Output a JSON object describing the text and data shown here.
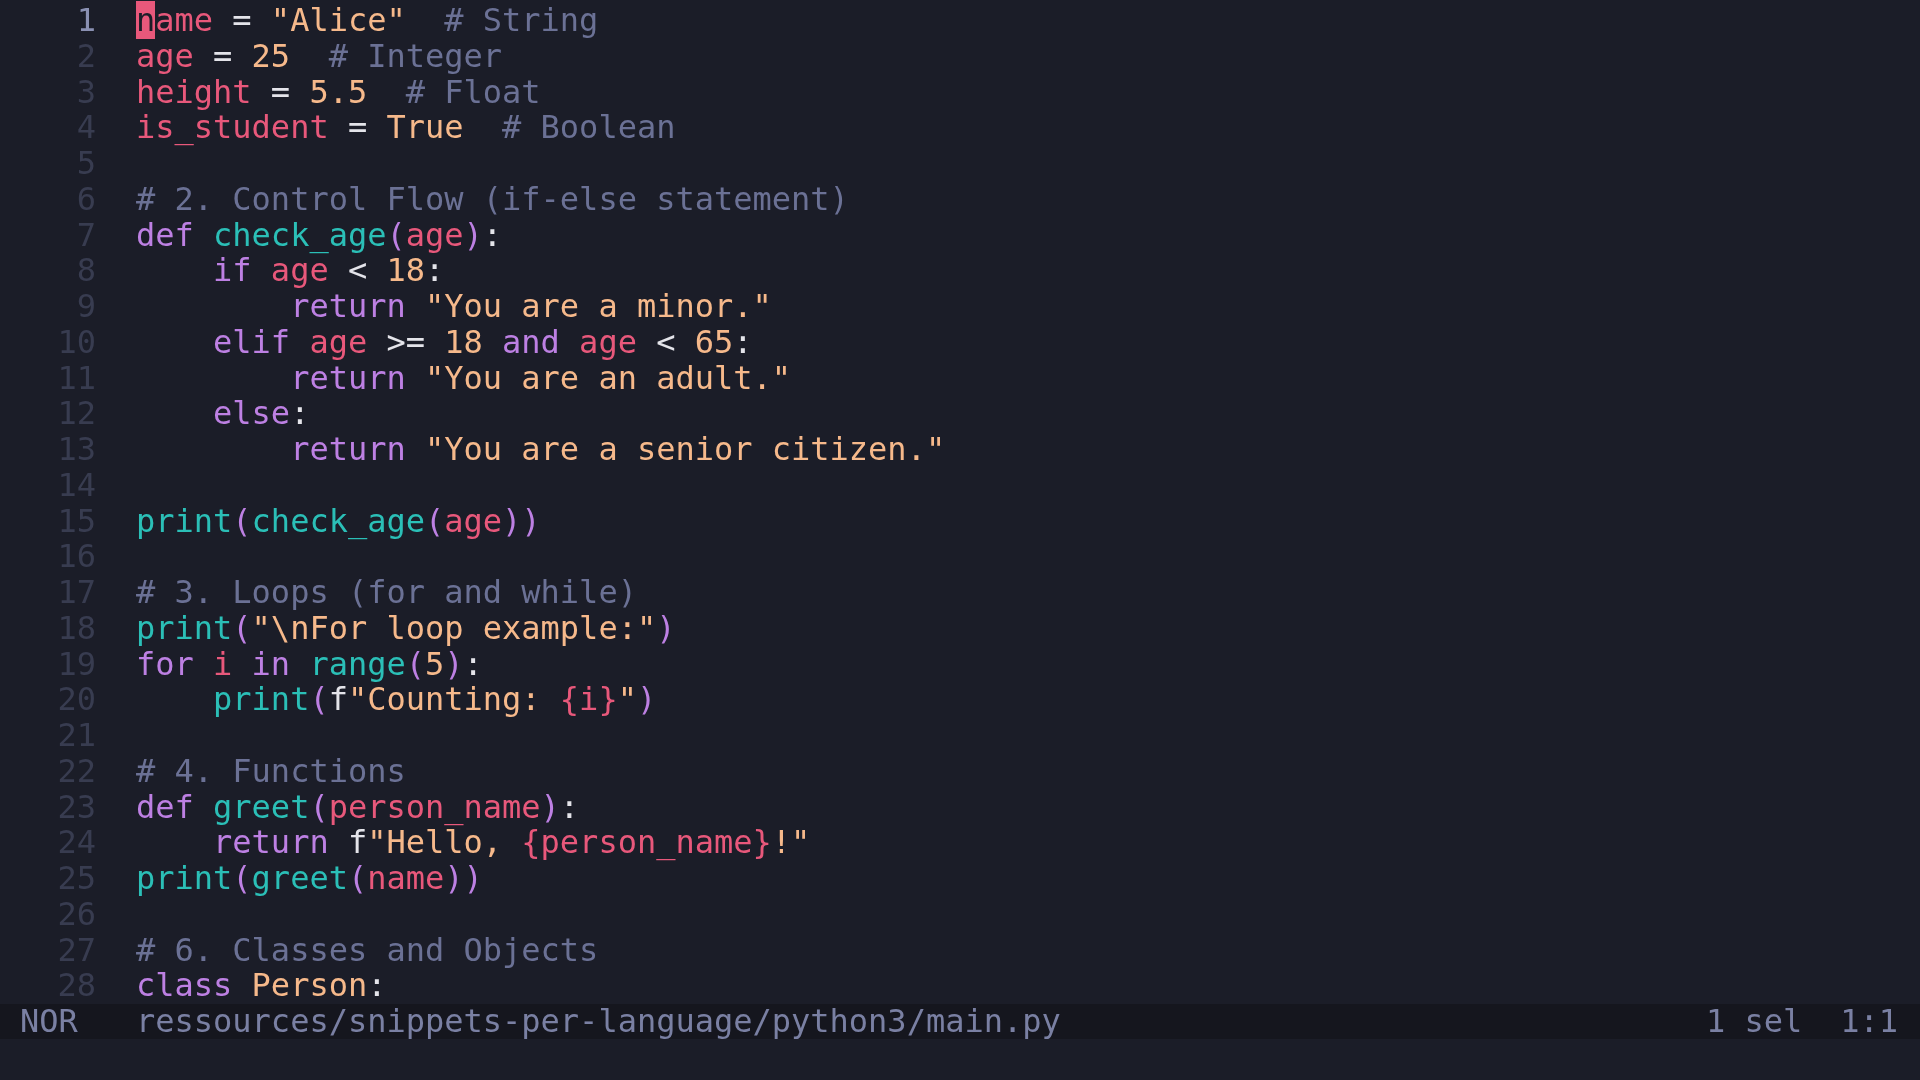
{
  "editor": {
    "lines": [
      {
        "number": "1",
        "current": true,
        "tokens": [
          {
            "kind": "cursor",
            "text": "n"
          },
          {
            "kind": "var",
            "text": "ame"
          },
          {
            "kind": "text",
            "text": " = "
          },
          {
            "kind": "str",
            "text": "\"Alice\""
          },
          {
            "kind": "comment",
            "text": "  # String"
          }
        ]
      },
      {
        "number": "2",
        "current": false,
        "tokens": [
          {
            "kind": "var",
            "text": "age"
          },
          {
            "kind": "text",
            "text": " = "
          },
          {
            "kind": "num",
            "text": "25"
          },
          {
            "kind": "comment",
            "text": "  # Integer"
          }
        ]
      },
      {
        "number": "3",
        "current": false,
        "tokens": [
          {
            "kind": "var",
            "text": "height"
          },
          {
            "kind": "text",
            "text": " = "
          },
          {
            "kind": "num",
            "text": "5.5"
          },
          {
            "kind": "comment",
            "text": "  # Float"
          }
        ]
      },
      {
        "number": "4",
        "current": false,
        "tokens": [
          {
            "kind": "var",
            "text": "is_student"
          },
          {
            "kind": "text",
            "text": " = "
          },
          {
            "kind": "num",
            "text": "True"
          },
          {
            "kind": "comment",
            "text": "  # Boolean"
          }
        ]
      },
      {
        "number": "5",
        "current": false
      },
      {
        "number": "6",
        "current": false,
        "tokens": [
          {
            "kind": "comment",
            "text": "# 2. Control Flow (if-else statement)"
          }
        ]
      },
      {
        "number": "7",
        "current": false,
        "tokens": [
          {
            "kind": "kw",
            "text": "def"
          },
          {
            "kind": "fn",
            "text": " check_age"
          },
          {
            "kind": "paren",
            "text": "("
          },
          {
            "kind": "var",
            "text": "age"
          },
          {
            "kind": "paren",
            "text": ")"
          },
          {
            "kind": "text",
            "text": ":"
          }
        ]
      },
      {
        "number": "8",
        "current": false,
        "tokens": [
          {
            "kind": "kw",
            "text": "    if"
          },
          {
            "kind": "var",
            "text": " age"
          },
          {
            "kind": "text",
            "text": " < "
          },
          {
            "kind": "num",
            "text": "18"
          },
          {
            "kind": "text",
            "text": ":"
          }
        ]
      },
      {
        "number": "9",
        "current": false,
        "tokens": [
          {
            "kind": "kw",
            "text": "        return"
          },
          {
            "kind": "str",
            "text": " \"You are a minor.\""
          }
        ]
      },
      {
        "number": "10",
        "current": false,
        "tokens": [
          {
            "kind": "kw",
            "text": "    elif"
          },
          {
            "kind": "var",
            "text": " age"
          },
          {
            "kind": "text",
            "text": " >= "
          },
          {
            "kind": "num",
            "text": "18"
          },
          {
            "kind": "kw",
            "text": " and"
          },
          {
            "kind": "var",
            "text": " age"
          },
          {
            "kind": "text",
            "text": " < "
          },
          {
            "kind": "num",
            "text": "65"
          },
          {
            "kind": "text",
            "text": ":"
          }
        ]
      },
      {
        "number": "11",
        "current": false,
        "tokens": [
          {
            "kind": "kw",
            "text": "        return"
          },
          {
            "kind": "str",
            "text": " \"You are an adult.\""
          }
        ]
      },
      {
        "number": "12",
        "current": false,
        "tokens": [
          {
            "kind": "kw",
            "text": "    else"
          },
          {
            "kind": "text",
            "text": ":"
          }
        ]
      },
      {
        "number": "13",
        "current": false,
        "tokens": [
          {
            "kind": "kw",
            "text": "        return"
          },
          {
            "kind": "str",
            "text": " \"You are a senior citizen.\""
          }
        ]
      },
      {
        "number": "14",
        "current": false
      },
      {
        "number": "15",
        "current": false,
        "tokens": [
          {
            "kind": "fn",
            "text": "print"
          },
          {
            "kind": "paren",
            "text": "("
          },
          {
            "kind": "fn",
            "text": "check_age"
          },
          {
            "kind": "paren",
            "text": "("
          },
          {
            "kind": "var",
            "text": "age"
          },
          {
            "kind": "paren",
            "text": "))"
          }
        ]
      },
      {
        "number": "16",
        "current": false
      },
      {
        "number": "17",
        "current": false,
        "tokens": [
          {
            "kind": "comment",
            "text": "# 3. Loops (for and while)"
          }
        ]
      },
      {
        "number": "18",
        "current": false,
        "tokens": [
          {
            "kind": "fn",
            "text": "print"
          },
          {
            "kind": "paren",
            "text": "("
          },
          {
            "kind": "str",
            "text": "\"\\nFor loop example:\""
          },
          {
            "kind": "paren",
            "text": ")"
          }
        ]
      },
      {
        "number": "19",
        "current": false,
        "tokens": [
          {
            "kind": "kw",
            "text": "for"
          },
          {
            "kind": "var",
            "text": " i"
          },
          {
            "kind": "kw",
            "text": " in"
          },
          {
            "kind": "fn",
            "text": " range"
          },
          {
            "kind": "paren",
            "text": "("
          },
          {
            "kind": "num",
            "text": "5"
          },
          {
            "kind": "paren",
            "text": ")"
          },
          {
            "kind": "text",
            "text": ":"
          }
        ]
      },
      {
        "number": "20",
        "current": false,
        "tokens": [
          {
            "kind": "fn",
            "text": "    print"
          },
          {
            "kind": "paren",
            "text": "("
          },
          {
            "kind": "text",
            "text": "f"
          },
          {
            "kind": "str",
            "text": "\"Counting: "
          },
          {
            "kind": "var",
            "text": "{i}"
          },
          {
            "kind": "str",
            "text": "\""
          },
          {
            "kind": "paren",
            "text": ")"
          }
        ]
      },
      {
        "number": "21",
        "current": false
      },
      {
        "number": "22",
        "current": false,
        "tokens": [
          {
            "kind": "comment",
            "text": "# 4. Functions"
          }
        ]
      },
      {
        "number": "23",
        "current": false,
        "tokens": [
          {
            "kind": "kw",
            "text": "def"
          },
          {
            "kind": "fn",
            "text": " greet"
          },
          {
            "kind": "paren",
            "text": "("
          },
          {
            "kind": "var",
            "text": "person_name"
          },
          {
            "kind": "paren",
            "text": ")"
          },
          {
            "kind": "text",
            "text": ":"
          }
        ]
      },
      {
        "number": "24",
        "current": false,
        "tokens": [
          {
            "kind": "kw",
            "text": "    return"
          },
          {
            "kind": "text",
            "text": " f"
          },
          {
            "kind": "str",
            "text": "\"Hello, "
          },
          {
            "kind": "var",
            "text": "{person_name}"
          },
          {
            "kind": "str",
            "text": "!\""
          }
        ]
      },
      {
        "number": "25",
        "current": false,
        "tokens": [
          {
            "kind": "fn",
            "text": "print"
          },
          {
            "kind": "paren",
            "text": "("
          },
          {
            "kind": "fn",
            "text": "greet"
          },
          {
            "kind": "paren",
            "text": "("
          },
          {
            "kind": "var",
            "text": "name"
          },
          {
            "kind": "paren",
            "text": "))"
          }
        ]
      },
      {
        "number": "26",
        "current": false
      },
      {
        "number": "27",
        "current": false,
        "tokens": [
          {
            "kind": "comment",
            "text": "# 6. Classes and Objects"
          }
        ]
      },
      {
        "number": "28",
        "current": false,
        "tokens": [
          {
            "kind": "kw",
            "text": "class"
          },
          {
            "kind": "type",
            "text": " Person"
          },
          {
            "kind": "text",
            "text": ":"
          }
        ]
      }
    ]
  },
  "status_bar": {
    "mode": "NOR",
    "file_path": "ressources/snippets-per-language/python3/main.py",
    "selections": "1 sel",
    "position": "1:1"
  }
}
